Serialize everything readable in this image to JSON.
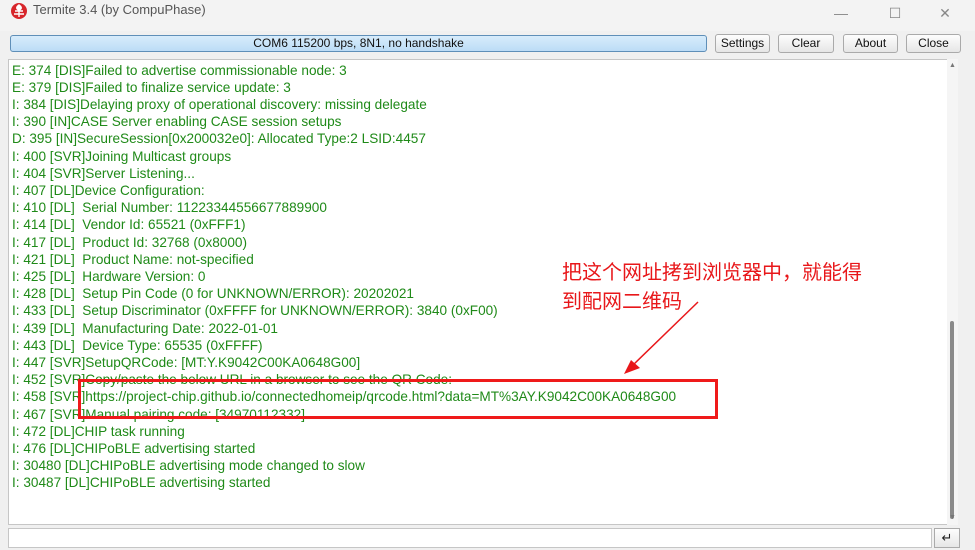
{
  "window": {
    "title": "Termite 3.4 (by CompuPhase)",
    "controls": {
      "minimize": "—",
      "maximize": "☐",
      "close": "✕"
    }
  },
  "toolbar": {
    "status": "COM6 115200 bps, 8N1, no handshake",
    "buttons": {
      "settings": "Settings",
      "clear": "Clear",
      "about": "About",
      "close": "Close"
    }
  },
  "terminal": {
    "lines": [
      "E: 374 [DIS]Failed to advertise commissionable node: 3",
      "E: 379 [DIS]Failed to finalize service update: 3",
      "I: 384 [DIS]Delaying proxy of operational discovery: missing delegate",
      "I: 390 [IN]CASE Server enabling CASE session setups",
      "D: 395 [IN]SecureSession[0x200032e0]: Allocated Type:2 LSID:4457",
      "I: 400 [SVR]Joining Multicast groups",
      "I: 404 [SVR]Server Listening...",
      "I: 407 [DL]Device Configuration:",
      "I: 410 [DL]  Serial Number: 11223344556677889900",
      "I: 414 [DL]  Vendor Id: 65521 (0xFFF1)",
      "I: 417 [DL]  Product Id: 32768 (0x8000)",
      "I: 421 [DL]  Product Name: not-specified",
      "I: 425 [DL]  Hardware Version: 0",
      "I: 428 [DL]  Setup Pin Code (0 for UNKNOWN/ERROR): 20202021",
      "I: 433 [DL]  Setup Discriminator (0xFFFF for UNKNOWN/ERROR): 3840 (0xF00)",
      "I: 439 [DL]  Manufacturing Date: 2022-01-01",
      "I: 443 [DL]  Device Type: 65535 (0xFFFF)",
      "I: 447 [SVR]SetupQRCode: [MT:Y.K9042C00KA0648G00]",
      "I: 452 [SVR]Copy/paste the below URL in a browser to see the QR Code:",
      "I: 458 [SVR]https://project-chip.github.io/connectedhomeip/qrcode.html?data=MT%3AY.K9042C00KA0648G00",
      "I: 467 [SVR]Manual pairing code: [34970112332]",
      "I: 472 [DL]CHIP task running",
      "I: 476 [DL]CHIPoBLE advertising started",
      "I: 30480 [DL]CHIPoBLE advertising mode changed to slow",
      "I: 30487 [DL]CHIPoBLE advertising started"
    ]
  },
  "annotation": {
    "line1": "把这个网址拷到浏览器中，就能得",
    "line2": "到配网二维码"
  },
  "input": {
    "send_label": "↵"
  },
  "colors": {
    "log_text": "#1f8a18",
    "annotation": "#e8171a",
    "status_fill": "#c9e3f8"
  }
}
